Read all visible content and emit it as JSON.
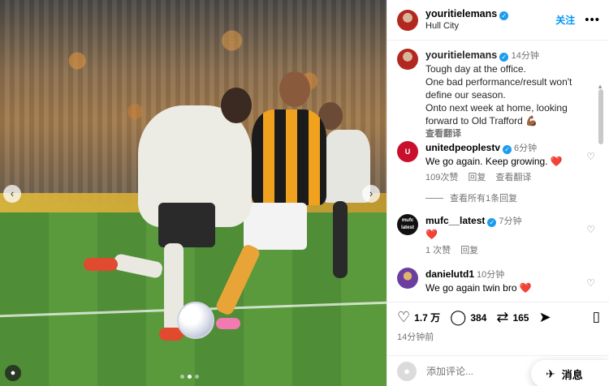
{
  "post": {
    "username": "youritielemans",
    "location": "Hull City",
    "follow_label": "关注",
    "more_icon": "more-horizontal-icon",
    "image_dots": 3,
    "active_dot": 1
  },
  "caption": {
    "username": "youritielemans",
    "time": "14分钟",
    "lines": [
      "Tough day at the office.",
      "One bad performance/result won't",
      "define our season.",
      "Onto next week at home, looking",
      "forward to Old Trafford 💪🏾"
    ],
    "translate_label": "查看翻译"
  },
  "comments": [
    {
      "username": "unitedpeoplestv",
      "verified": true,
      "time": "6分钟",
      "text": "We go again. Keep growing. ❤️",
      "likes": "109次赞",
      "reply_label": "回复",
      "translate_label": "查看翻译",
      "avatar_text": "U",
      "avatar_color": "#c8102e"
    },
    {
      "username": "mufc__latest",
      "verified": true,
      "time": "7分钟",
      "text": "❤️",
      "likes": "1 次赞",
      "reply_label": "回复",
      "avatar_text": "mufc latest",
      "avatar_color": "#111111"
    },
    {
      "username": "danielutd1",
      "verified": false,
      "time": "10分钟",
      "text": "We go again twin bro ❤️",
      "avatar_text": "",
      "avatar_color": "#6b3fa0"
    }
  ],
  "view_replies_label": "查看所有1条回复",
  "actions": {
    "likes": "1.7 万",
    "comments": "384",
    "shares": "165",
    "posted": "14分钟前"
  },
  "comment_bar": {
    "placeholder": "添加评论..."
  },
  "messages_label": "消息",
  "colors": {
    "link_blue": "#0095f6",
    "verified_blue": "#1d9bf0",
    "heart_red": "#ed1848"
  }
}
